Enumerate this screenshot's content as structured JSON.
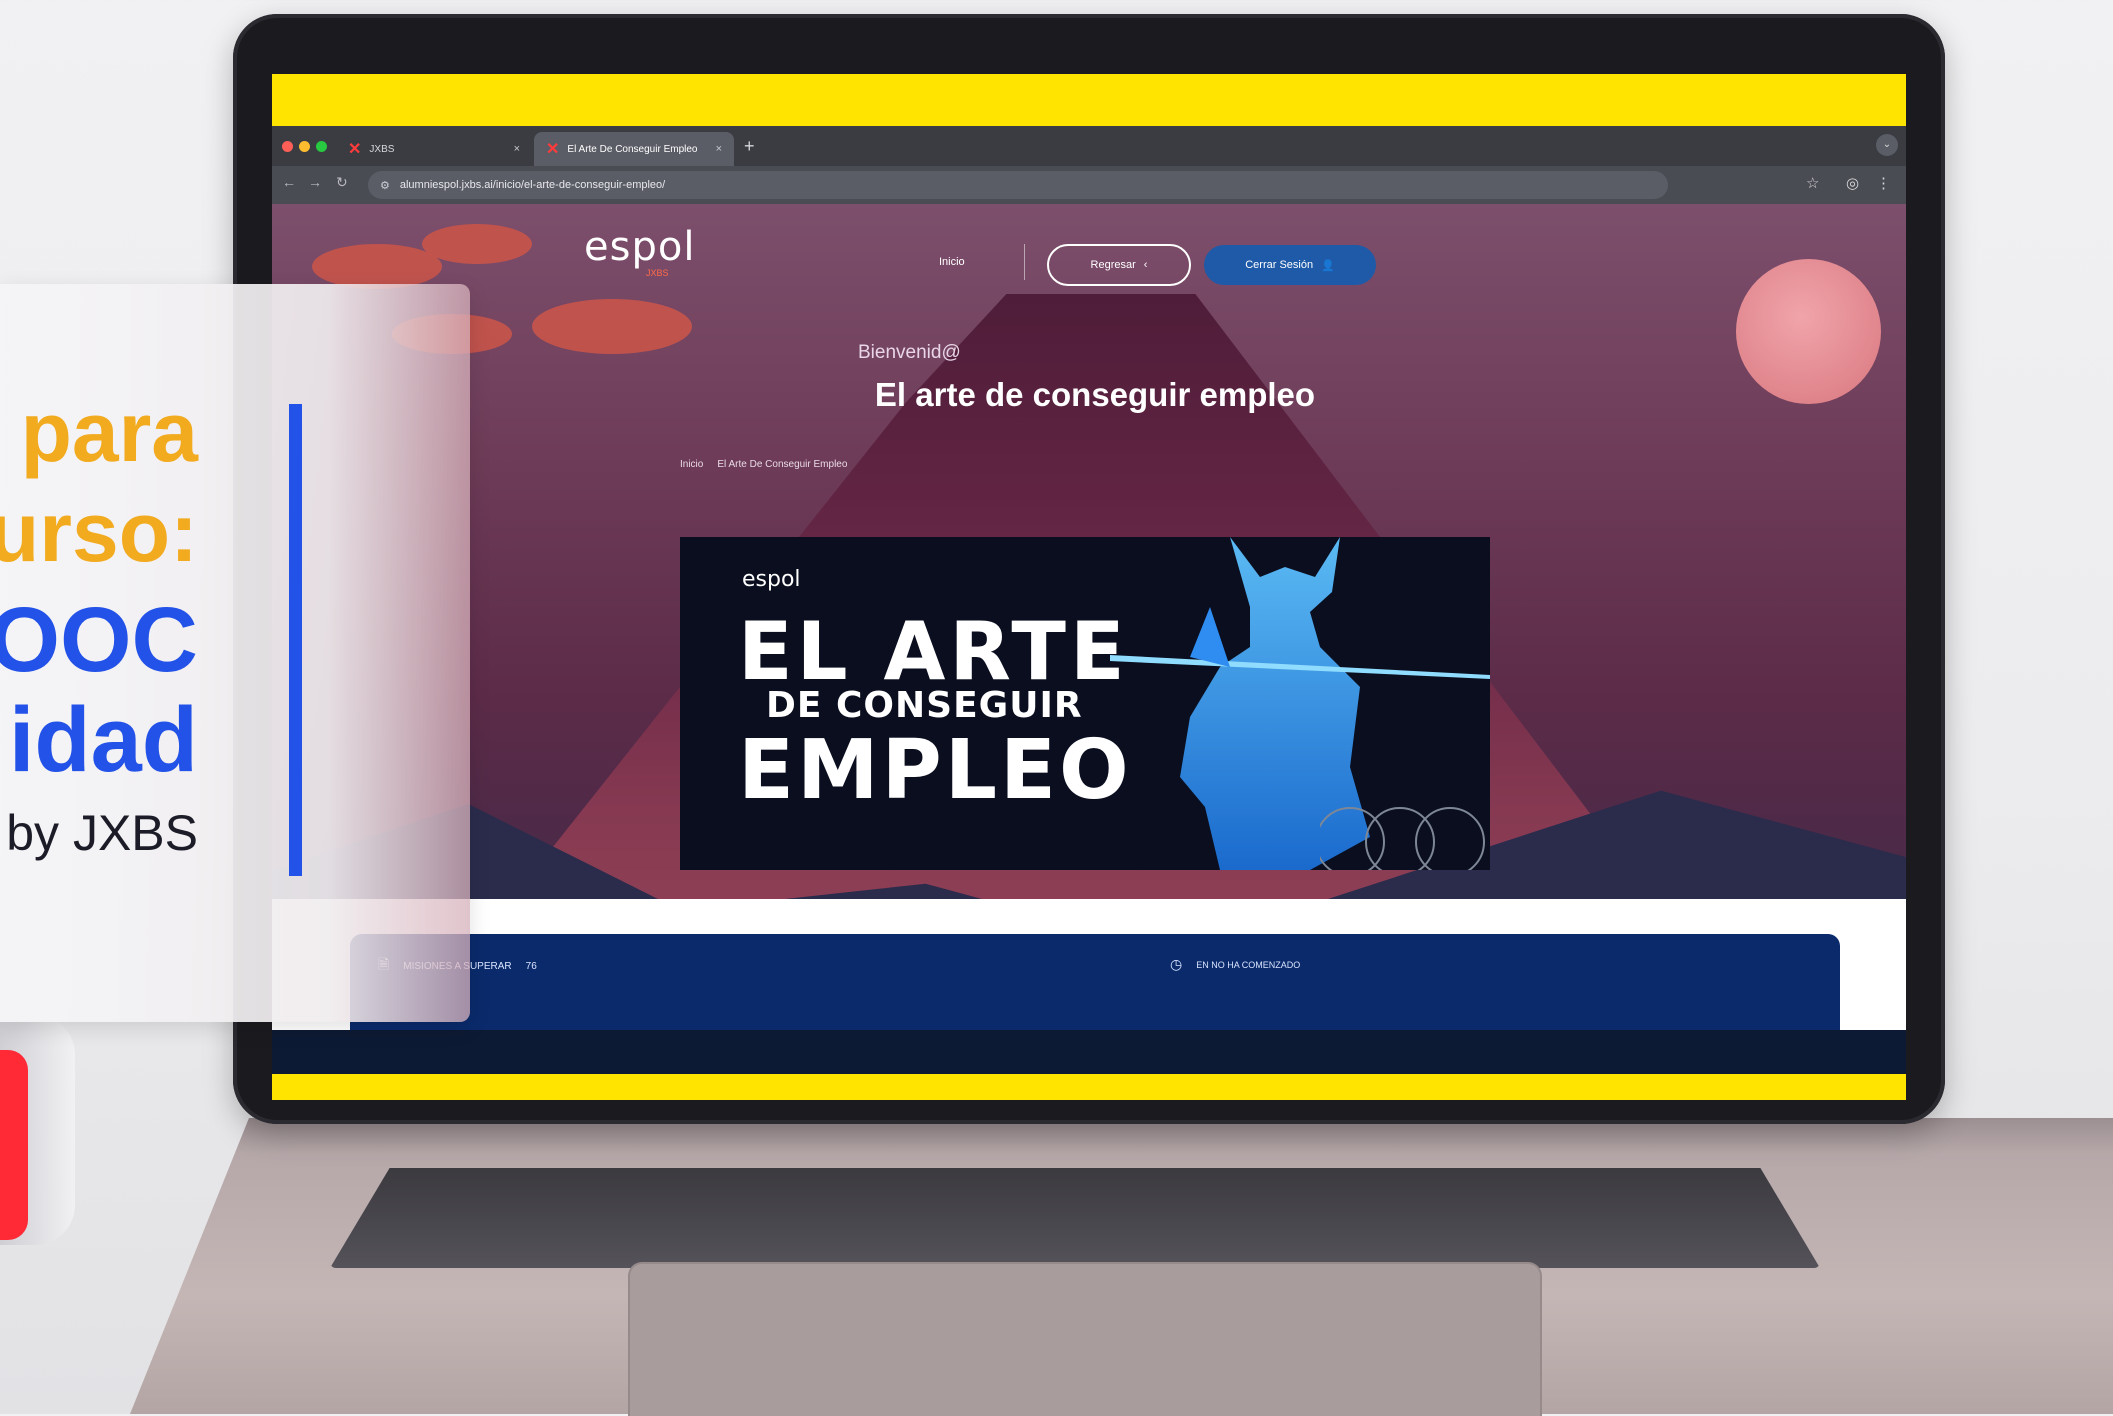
{
  "promo": {
    "line1": "para",
    "line2": "urso:",
    "line3": "OOC",
    "line4": "idad",
    "line5": "by JXBS"
  },
  "browser": {
    "tabs": [
      {
        "label": "JXBS",
        "icon": "x-logo-icon"
      },
      {
        "label": "El Arte De Conseguir Empleo",
        "icon": "x-logo-icon"
      }
    ],
    "url": "alumniespol.jxbs.ai/inicio/el-arte-de-conseguir-empleo/"
  },
  "site": {
    "logo": "espol",
    "logo_sub": "JXBS",
    "nav": {
      "home": "Inicio",
      "back": "Regresar",
      "logout": "Cerrar Sesión"
    },
    "welcome": "Bienvenid@",
    "course_title": "El arte de conseguir empleo",
    "breadcrumb": [
      "Inicio",
      "El Arte De Conseguir Empleo"
    ]
  },
  "banner": {
    "logo": "espol",
    "line1": "EL ARTE",
    "line2": "DE CONSEGUIR",
    "line3": "EMPLEO"
  },
  "info_bar": {
    "missions_label": "MISIONES A SUPERAR",
    "missions_count": "76",
    "status": "EN NO HA COMENZADO"
  },
  "colors": {
    "accent_yellow": "#ffe400",
    "promo_orange": "#f2aa1f",
    "promo_blue": "#2352e8",
    "button_blue": "#1e5aa8",
    "info_bar_navy": "#0a2a6b"
  }
}
